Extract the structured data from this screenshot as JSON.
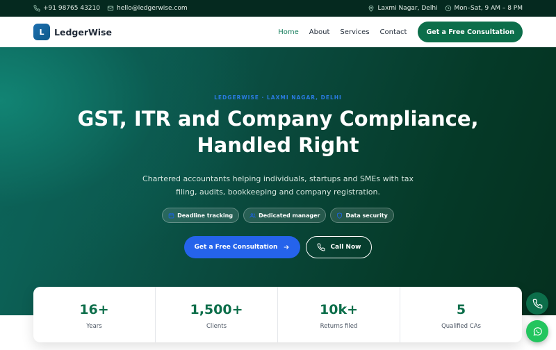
{
  "topbar": {
    "phone": "+91 98765 43210",
    "email": "hello@ledgerwise.com",
    "location": "Laxmi Nagar, Delhi",
    "hours": "Mon–Sat, 9 AM – 8 PM"
  },
  "nav": {
    "brand_initial": "L",
    "brand_name": "LedgerWise",
    "links": [
      "Home",
      "About",
      "Services",
      "Contact"
    ],
    "cta": "Get a Free Consultation"
  },
  "hero": {
    "eyebrow": "LEDGERWISE · LAXMI NAGAR, DELHI",
    "title": "GST, ITR and Company Compliance, Handled Right",
    "subtitle": "Chartered accountants helping individuals, startups and SMEs with tax filing, audits, bookkeeping and company registration.",
    "pills": [
      "Deadline tracking",
      "Dedicated manager",
      "Data security"
    ],
    "primary_cta": "Get a Free Consultation",
    "secondary_cta": "Call Now"
  },
  "stats": [
    {
      "value": "16+",
      "label": "Years"
    },
    {
      "value": "1,500+",
      "label": "Clients"
    },
    {
      "value": "10k+",
      "label": "Returns filed"
    },
    {
      "value": "5",
      "label": "Qualified CAs"
    }
  ],
  "icons": {
    "phone": "phone-icon",
    "email": "mail-icon",
    "location": "map-pin-icon",
    "hours": "clock-icon",
    "arrow": "arrow-right-icon",
    "whatsapp": "whatsapp-icon"
  },
  "colors": {
    "brand_green": "#0c6e4a",
    "primary_blue": "#2563eb",
    "topbar_bg": "#05291f",
    "whatsapp_green": "#22c55e"
  }
}
